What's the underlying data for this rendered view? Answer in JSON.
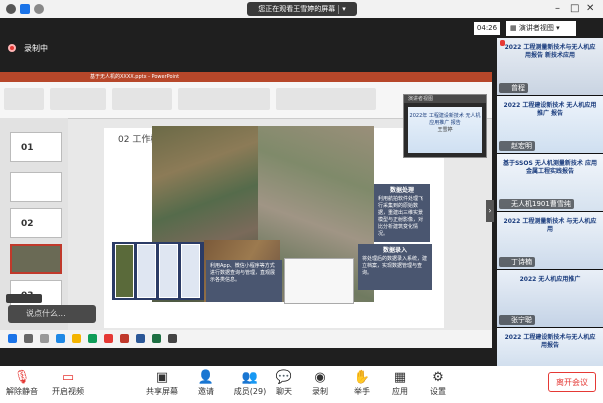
{
  "window": {
    "share_status": "您正在观看王雪婷的屏幕",
    "timer": "04:26",
    "view_button": "演讲者视图"
  },
  "recording": {
    "label": "录制中"
  },
  "ppt": {
    "title_text": "基于无人机的XXXX.pptx - PowerPoint",
    "slide_heading": "02 工作概",
    "thumbs": [
      "01",
      "02",
      "03"
    ],
    "panel1_title": "数据处理",
    "panel1_body": "利用航拍软件处理飞行采集到的原始数据，重建出三维实景模型与正射影像，对比分析建筑变化情况。",
    "panel2_title": "数据录入",
    "panel2_body": "将处理后的数据录入系统，建立档案，实现数据管理与查询。",
    "panel3_body": "利用App、微信小程序等方式进行数据查询与管理，直观展示各类信息。"
  },
  "cam_overlay": {
    "label": "演讲者视图",
    "slide_text": "2022年 工程建设新技术 无人机应用推广 报告",
    "name": "王雪婷"
  },
  "comment_chip": {
    "placeholder": "说点什么..."
  },
  "participants": [
    {
      "name": "曾程",
      "caption": "2022 工程测量新技术与无人机应用报告 新技术应用"
    },
    {
      "name": "赵宏明",
      "caption": "2022 工程建设新技术 无人机应用推广 报告"
    },
    {
      "name": "无人机1901曹雪纯",
      "caption": "基于SSOS 无人机测量新技术 应用 金属工程实践报告"
    },
    {
      "name": "丁诗楠",
      "caption": "2022 工程测量新技术 与无人机应用"
    },
    {
      "name": "张宁聪",
      "caption": "2022 无人机应用推广"
    },
    {
      "name": "",
      "caption": "2022 工程建设新技术与无人机应用报告"
    }
  ],
  "controls": {
    "mute": "解除静音",
    "video": "开启视频",
    "share": "共享屏幕",
    "invite": "邀请",
    "members": "成员(29)",
    "chat": "聊天",
    "record": "录制",
    "hand": "举手",
    "apps": "应用",
    "settings": "设置",
    "leave": "离开会议"
  }
}
